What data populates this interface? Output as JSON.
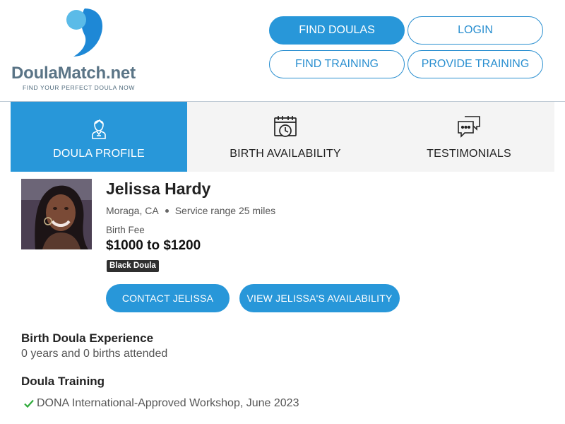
{
  "brand": {
    "name": "DoulaMatch.net",
    "tagline": "FIND YOUR PERFECT DOULA NOW",
    "colors": {
      "primary": "#2897d9",
      "logo_light": "#5bbbe8",
      "logo_dark": "#1e88d6",
      "text_gray": "#5a7486"
    }
  },
  "nav": {
    "find_doulas": "FIND DOULAS",
    "login": "LOGIN",
    "find_training": "FIND TRAINING",
    "provide_training": "PROVIDE TRAINING"
  },
  "tabs": [
    {
      "label": "DOULA PROFILE",
      "icon": "person-icon",
      "active": true
    },
    {
      "label": "BIRTH AVAILABILITY",
      "icon": "calendar-clock-icon",
      "active": false
    },
    {
      "label": "TESTIMONIALS",
      "icon": "chat-bubbles-icon",
      "active": false
    }
  ],
  "profile": {
    "name": "Jelissa Hardy",
    "location": "Moraga, CA",
    "service_range": "Service range 25 miles",
    "fee_label": "Birth Fee",
    "fee_value": "$1000 to $1200",
    "badge": "Black Doula",
    "contact_button": "CONTACT JELISSA",
    "availability_button": "VIEW JELISSA'S AVAILABILITY"
  },
  "experience": {
    "title": "Birth Doula Experience",
    "text": "0 years and 0 births attended"
  },
  "training": {
    "title": "Doula Training",
    "items": [
      "DONA International-Approved Workshop, June 2023"
    ],
    "check_color": "#2eaa3a"
  }
}
